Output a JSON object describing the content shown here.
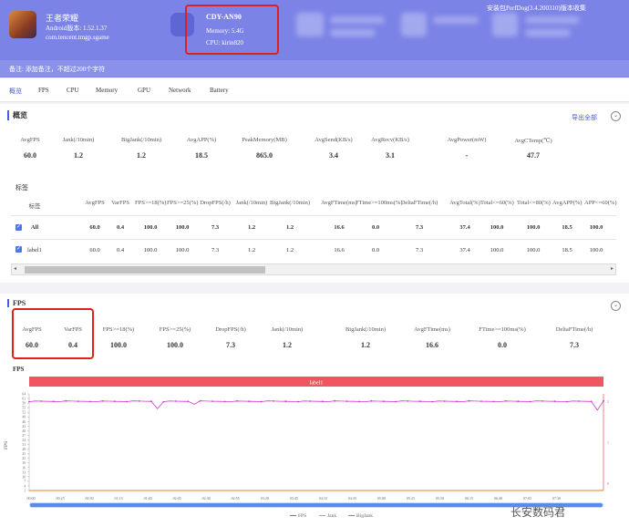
{
  "app": {
    "name": "王者荣耀",
    "version": "Android版本: 1.52.1.37",
    "package": "com.tencent.tmgp.sgame"
  },
  "device": {
    "name": "CDY-AN90",
    "memory": "Memory: 5.4G",
    "cpu": "CPU: kirin820"
  },
  "install_note": "安装包PerfDog(3.4.200310)版本收集",
  "note": "备注: 添加备注，不超过200个字符",
  "tabs": [
    "概览",
    "FPS",
    "CPU",
    "Memory",
    "GPU",
    "Network",
    "Battery"
  ],
  "overview": {
    "title": "概览",
    "export": "导出全部",
    "stats": [
      {
        "label": "AvgFPS",
        "value": "60.0"
      },
      {
        "label": "Jank(/10min)",
        "value": "1.2"
      },
      {
        "label": "BigJank(/10min)",
        "value": "1.2"
      },
      {
        "label": "AvgAPP(%)",
        "value": "18.5"
      },
      {
        "label": "PeakMemory(MB)",
        "value": "865.0"
      },
      {
        "label": "AvgSend(KB/s)",
        "value": "3.4"
      },
      {
        "label": "AvgRecv(KB/s)",
        "value": "3.1"
      },
      {
        "label": "AvgPower(mW)",
        "value": "-"
      },
      {
        "label": "AvgCTemp(℃)",
        "value": "47.7"
      }
    ],
    "table_label": "标签",
    "headers": [
      "标签",
      "AvgFPS",
      "VarFPS",
      "FPS>=18(%)",
      "FPS>=25(%)",
      "DropFPS(/h)",
      "Jank(/10min)",
      "BigJank(/10min)",
      "AvgFTime(ms)",
      "FTime>=100ms(%)",
      "DeltaFTime(/h)",
      "AvgTotal(%)",
      "Total<=60(%)",
      "Total<=80(%)",
      "AvgAPP(%)",
      "APP<=60(%)"
    ],
    "rows": [
      [
        "All",
        "60.0",
        "0.4",
        "100.0",
        "100.0",
        "7.3",
        "1.2",
        "1.2",
        "16.6",
        "0.0",
        "7.3",
        "37.4",
        "100.0",
        "100.0",
        "18.5",
        "100.0"
      ],
      [
        "label1",
        "60.0",
        "0.4",
        "100.0",
        "100.0",
        "7.3",
        "1.2",
        "1.2",
        "16.6",
        "0.0",
        "7.3",
        "37.4",
        "100.0",
        "100.0",
        "18.5",
        "100.0"
      ]
    ]
  },
  "fps_section": {
    "title": "FPS",
    "stats": [
      {
        "label": "AvgFPS",
        "value": "60.0"
      },
      {
        "label": "VarFPS",
        "value": "0.4"
      },
      {
        "label": "FPS>=18(%)",
        "value": "100.0"
      },
      {
        "label": "FPS>=25(%)",
        "value": "100.0"
      },
      {
        "label": "DropFPS(/h)",
        "value": "7.3"
      },
      {
        "label": "Jank(/10min)",
        "value": "1.2"
      },
      {
        "label": "BigJank(/10min)",
        "value": "1.2"
      },
      {
        "label": "AvgFTime(ms)",
        "value": "16.6"
      },
      {
        "label": "FTime>=100ms(%)",
        "value": "0.0"
      },
      {
        "label": "DeltaFTime(/h)",
        "value": "7.3"
      }
    ],
    "chart_label": "FPS",
    "band_label": "label1",
    "legend": [
      "FPS",
      "Jank",
      "BigJank"
    ]
  },
  "colors": {
    "header": "#7b83e6",
    "accent": "#4a5ae0",
    "fps_line": "#d23bd0",
    "band": "#ef5660",
    "axis_right": "#d46a6a",
    "annotation": "#e01f1f"
  },
  "watermark": "长安数码君",
  "chart_data": {
    "type": "line",
    "y_left_label": "FPS",
    "y_left_ticks": [
      "64",
      "61",
      "58",
      "55",
      "52",
      "49",
      "46",
      "43",
      "40",
      "37",
      "34",
      "31",
      "28",
      "25",
      "22",
      "19",
      "16",
      "13",
      "10",
      "7",
      "4",
      "1"
    ],
    "y_right_ticks": [
      "2",
      "1",
      "0"
    ],
    "x": [
      "00:00",
      "00:25",
      "00:50",
      "01:15",
      "01:40",
      "02:05",
      "02:30",
      "02:55",
      "03:20",
      "03:45",
      "04:10",
      "04:35",
      "05:00",
      "05:25",
      "05:50",
      "06:15",
      "06:40",
      "07:05",
      "07:30"
    ],
    "series": [
      {
        "name": "FPS",
        "baseline": 60,
        "dips": [
          {
            "x": "01:47",
            "value": 55
          },
          {
            "x": "02:13",
            "value": 58
          },
          {
            "x": "07:44",
            "value": 54
          }
        ]
      }
    ],
    "ylim": [
      0,
      65
    ]
  }
}
